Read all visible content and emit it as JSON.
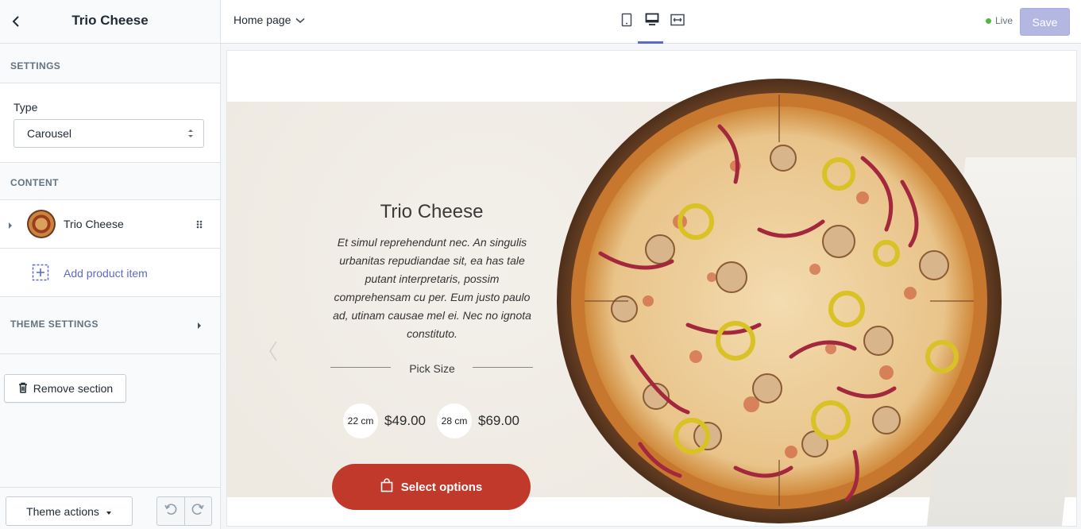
{
  "sidebar": {
    "title": "Trio Cheese",
    "settings_label": "SETTINGS",
    "type_label": "Type",
    "type_value": "Carousel",
    "content_label": "CONTENT",
    "item_label": "Trio Cheese",
    "add_item_label": "Add product item",
    "theme_settings_label": "THEME SETTINGS",
    "remove_label": "Remove section",
    "theme_actions_label": "Theme actions"
  },
  "topbar": {
    "page_select": "Home page",
    "live_label": "Live",
    "save_label": "Save"
  },
  "product": {
    "title": "Trio Cheese",
    "description": "Et simul reprehendunt nec. An singulis urbanitas repudiandae sit, ea has tale putant interpretaris, possim comprehensam cu per. Eum justo paulo ad, utinam causae mel ei. Nec no ignota constituto.",
    "pick_size_label": "Pick Size",
    "sizes": [
      {
        "size": "22 cm",
        "price": "$49.00"
      },
      {
        "size": "28 cm",
        "price": "$69.00"
      }
    ],
    "cta_label": "Select options"
  },
  "colors": {
    "accent": "#5c6ac4",
    "cta": "#c0392b",
    "live": "#50b83c",
    "save_disabled": "#b3b7e1"
  },
  "icons": [
    "back-icon",
    "select-arrows-icon",
    "caret-right-icon",
    "drag-handle-icon",
    "add-item-icon",
    "trash-icon",
    "caret-down-icon",
    "undo-icon",
    "redo-icon",
    "chevron-down-icon",
    "mobile-icon",
    "desktop-icon",
    "fullwidth-icon",
    "bag-icon",
    "carousel-prev-icon"
  ]
}
